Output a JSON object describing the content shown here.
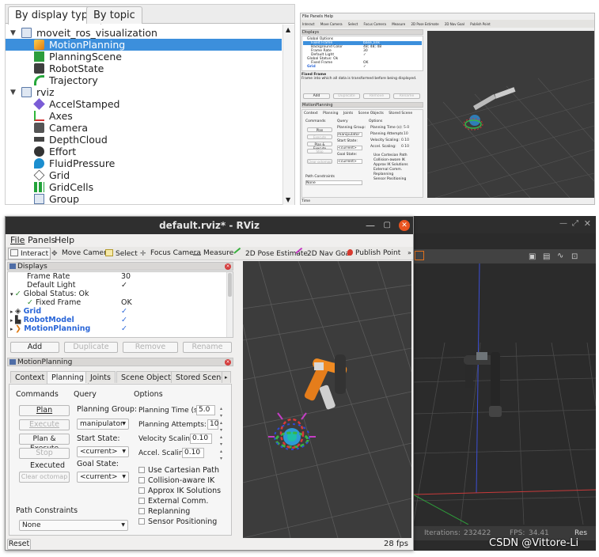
{
  "panel1": {
    "tabs": [
      "By display type",
      "By topic"
    ],
    "tree": [
      {
        "label": "moveit_ros_visualization",
        "level": 0,
        "kind": "folder",
        "expanded": true
      },
      {
        "label": "MotionPlanning",
        "level": 1,
        "kind": "motion-planning",
        "selected": true
      },
      {
        "label": "PlanningScene",
        "level": 1,
        "kind": "planning-scene"
      },
      {
        "label": "RobotState",
        "level": 1,
        "kind": "robot-state"
      },
      {
        "label": "Trajectory",
        "level": 1,
        "kind": "trajectory"
      },
      {
        "label": "rviz",
        "level": 0,
        "kind": "folder",
        "expanded": true
      },
      {
        "label": "AccelStamped",
        "level": 1,
        "kind": "accel"
      },
      {
        "label": "Axes",
        "level": 1,
        "kind": "axes"
      },
      {
        "label": "Camera",
        "level": 1,
        "kind": "camera"
      },
      {
        "label": "DepthCloud",
        "level": 1,
        "kind": "depthcloud"
      },
      {
        "label": "Effort",
        "level": 1,
        "kind": "effort"
      },
      {
        "label": "FluidPressure",
        "level": 1,
        "kind": "fluid"
      },
      {
        "label": "Grid",
        "level": 1,
        "kind": "grid"
      },
      {
        "label": "GridCells",
        "level": 1,
        "kind": "gridcells"
      },
      {
        "label": "Group",
        "level": 1,
        "kind": "group"
      }
    ]
  },
  "panel2": {
    "menu": [
      "File",
      "Panels",
      "Help"
    ],
    "toolbar": [
      "Interact",
      "Move Camera",
      "Select",
      "Focus Camera",
      "Measure",
      "2D Pose Estimate",
      "2D Nav Goal",
      "Publish Point"
    ],
    "displays_title": "Displays",
    "rows": [
      {
        "label": "Global Options",
        "value": ""
      },
      {
        "label": "Fixed Frame",
        "value": "base_link"
      },
      {
        "label": "Background Color",
        "value": "48; 48; 48"
      },
      {
        "label": "Frame Rate",
        "value": "30"
      },
      {
        "label": "Default Light",
        "value": "✓"
      },
      {
        "label": "Global Status: Ok",
        "value": ""
      },
      {
        "label": "Fixed Frame",
        "value": "OK"
      },
      {
        "label": "Grid",
        "value": "✓"
      }
    ],
    "desc_title": "Fixed Frame",
    "desc_text": "Frame into which all data is transformed before being displayed.",
    "buttons": [
      "Add",
      "Duplicate",
      "Remove",
      "Rename"
    ],
    "mp_title": "MotionPlanning",
    "tabs": [
      "Context",
      "Planning",
      "Joints",
      "Scene Objects",
      "Stored Scene"
    ],
    "time_label": "Time"
  },
  "window": {
    "title": "default.rviz* - RViz",
    "menu": [
      "File",
      "Panels",
      "Help"
    ],
    "toolbar": [
      {
        "label": "Interact",
        "icon": "interact-icon"
      },
      {
        "label": "Move Camera",
        "icon": "move-camera-icon"
      },
      {
        "label": "Select",
        "icon": "select-icon"
      },
      {
        "label": "Focus Camera",
        "icon": "focus-camera-icon"
      },
      {
        "label": "Measure",
        "icon": "measure-icon"
      },
      {
        "label": "2D Pose Estimate",
        "icon": "pose-estimate-icon"
      },
      {
        "label": "2D Nav Goal",
        "icon": "nav-goal-icon"
      },
      {
        "label": "Publish Point",
        "icon": "publish-point-icon"
      }
    ],
    "displays_title": "Displays",
    "display_rows": [
      {
        "label": "Frame Rate",
        "value": "30"
      },
      {
        "label": "Default Light",
        "value": "✓"
      },
      {
        "label": "Global Status: Ok",
        "value": ""
      },
      {
        "label": "Fixed Frame",
        "value": "OK"
      },
      {
        "label": "Grid",
        "value": "✓"
      },
      {
        "label": "RobotModel",
        "value": "✓"
      },
      {
        "label": "MotionPlanning",
        "value": "✓"
      }
    ],
    "buttons": {
      "add": "Add",
      "duplicate": "Duplicate",
      "remove": "Remove",
      "rename": "Rename"
    },
    "mp_title": "MotionPlanning",
    "tabs": [
      "Context",
      "Planning",
      "Joints",
      "Scene Objects",
      "Stored Scene"
    ],
    "headers": {
      "commands": "Commands",
      "query": "Query",
      "options": "Options"
    },
    "commands": {
      "plan": "Plan",
      "execute": "Execute",
      "plan_execute": "Plan & Execute",
      "stop": "Stop",
      "executed": "Executed",
      "clear_octomap": "Clear octomap"
    },
    "query": {
      "group_label": "Planning Group:",
      "group_value": "manipulator",
      "start_label": "Start State:",
      "start_value": "<current>",
      "goal_label": "Goal State:",
      "goal_value": "<current>"
    },
    "options": {
      "planning_time_label": "Planning Time (s):",
      "planning_time": "5.0",
      "attempts_label": "Planning Attempts:",
      "attempts": "10",
      "velocity_label": "Velocity Scaling:",
      "velocity": "0.10",
      "accel_label": "Accel. Scaling:",
      "accel": "0.10",
      "checks": [
        "Use Cartesian Path",
        "Collision-aware IK",
        "Approx IK Solutions",
        "External Comm.",
        "Replanning",
        "Sensor Positioning"
      ]
    },
    "path_constraints_label": "Path Constraints",
    "path_constraints_value": "None",
    "reset": "Reset",
    "fps": "28 fps"
  },
  "bg": {
    "iterations_label": "Iterations:",
    "iterations": "232422",
    "fps_label": "FPS:",
    "fps": "34.41",
    "res": "Res"
  },
  "watermark": "CSDN @Vittore-Li"
}
